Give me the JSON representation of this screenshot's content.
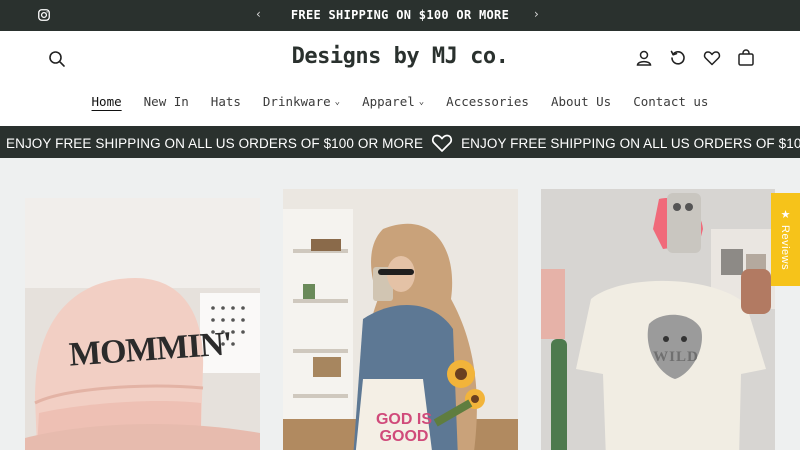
{
  "announcement": {
    "message": "FREE SHIPPING ON $100 OR MORE",
    "prev_arrow": "‹",
    "next_arrow": "›"
  },
  "header": {
    "logo": "Designs by MJ co.",
    "icons": [
      "search-icon",
      "account-icon",
      "refresh-icon",
      "wishlist-icon",
      "cart-icon"
    ]
  },
  "nav": {
    "items": [
      {
        "label": "Home",
        "active": true
      },
      {
        "label": "New In"
      },
      {
        "label": "Hats"
      },
      {
        "label": "Drinkware",
        "dropdown": true
      },
      {
        "label": "Apparel",
        "dropdown": true
      },
      {
        "label": "Accessories"
      },
      {
        "label": "About Us"
      },
      {
        "label": "Contact us"
      }
    ],
    "dropdown_glyph": "⌄"
  },
  "marquee": {
    "text": "ENJOY FREE SHIPPING ON ALL US ORDERS OF $100 OR MORE"
  },
  "gallery": {
    "cards": [
      {
        "hat_text": "MOMMIN'"
      },
      {
        "bag_text": "GOD IS GOOD"
      },
      {
        "tee_text": "WILD"
      }
    ]
  },
  "reviews_tab": {
    "label": "★ Reviews"
  },
  "colors": {
    "dark_bar": "#2a312e",
    "reviews_yellow": "#f6c31a",
    "gallery_bg": "#eef0f0"
  }
}
